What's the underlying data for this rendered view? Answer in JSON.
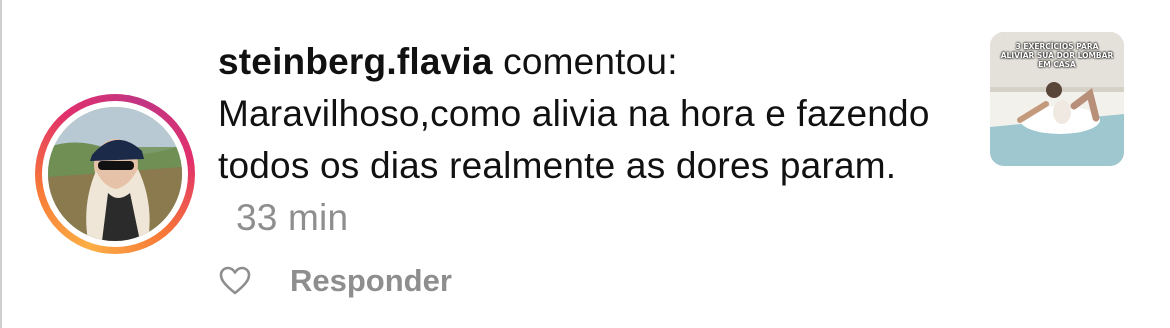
{
  "comment": {
    "username": "steinberg.flavia",
    "action": "comentou:",
    "text": "Maravilhoso,como alivia na hora e fazendo todos os dias realmente as dores param.",
    "time": "33 min"
  },
  "actions": {
    "reply_label": "Responder",
    "like_icon": "heart-outline-icon"
  },
  "thumbnail": {
    "caption_line1": "3 EXERCÍCIOS PARA",
    "caption_line2": "ALIVIAR SUA DOR LOMBAR",
    "caption_line3": "EM CASA"
  },
  "colors": {
    "text": "#111111",
    "muted": "#8e8e8e",
    "ring_gradient": [
      "#fcaf45",
      "#f77737",
      "#e1306c",
      "#c13584"
    ]
  }
}
